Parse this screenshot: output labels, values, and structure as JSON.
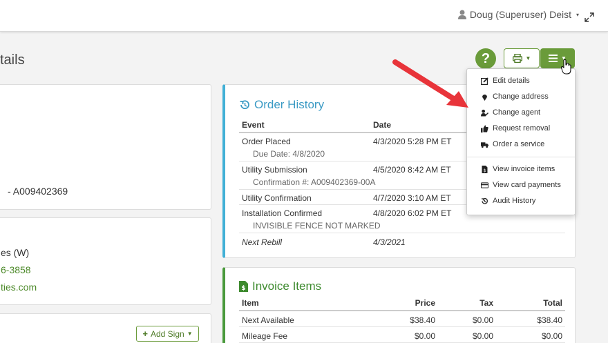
{
  "header": {
    "user_name": "Doug (Superuser) Deist",
    "page_title": "tails"
  },
  "left_panels": {
    "account_text": "- A009402369",
    "contact_label": "es (W)",
    "phone": "6-3858",
    "email": "ties.com",
    "add_sign_label": "Add Sign"
  },
  "order_history": {
    "title": "Order History",
    "columns": [
      "Event",
      "Date"
    ],
    "rows": [
      {
        "event": "Order Placed",
        "detail": "Due Date: 4/8/2020",
        "date": "4/3/2020 5:28 PM ET"
      },
      {
        "event": "Utility Submission",
        "detail": "Confirmation #: A009402369-00A",
        "date": "4/5/2020 8:42 AM ET"
      },
      {
        "event": "Utility Confirmation",
        "detail": "",
        "date": "4/7/2020 3:10 AM ET"
      },
      {
        "event": "Installation Confirmed",
        "detail": "INVISIBLE FENCE NOT MARKED",
        "date": "4/8/2020 6:02 PM ET"
      },
      {
        "event": "Next Rebill",
        "detail": "",
        "date": "4/3/2021"
      }
    ]
  },
  "invoice_items": {
    "title": "Invoice Items",
    "columns": [
      "Item",
      "Price",
      "Tax",
      "Total"
    ],
    "rows": [
      {
        "item": "Next Available",
        "price": "$38.40",
        "tax": "$0.00",
        "total": "$38.40"
      },
      {
        "item": "Mileage Fee",
        "price": "$0.00",
        "tax": "$0.00",
        "total": "$0.00"
      }
    ]
  },
  "actions_menu": {
    "items": [
      {
        "label": "Edit details",
        "icon": "edit-icon"
      },
      {
        "label": "Change address",
        "icon": "map-pin-icon"
      },
      {
        "label": "Change agent",
        "icon": "user-edit-icon"
      },
      {
        "label": "Request removal",
        "icon": "thumbs-up-icon"
      },
      {
        "label": "Order a service",
        "icon": "truck-icon"
      },
      {
        "label": "View invoice items",
        "icon": "invoice-icon"
      },
      {
        "label": "View card payments",
        "icon": "credit-card-icon"
      },
      {
        "label": "Audit History",
        "icon": "history-icon"
      }
    ]
  },
  "colors": {
    "brand_green": "#6a9b3a",
    "order_history_accent": "#41b0d6",
    "invoice_accent": "#4a9a3c",
    "annotation_arrow": "#e8343a"
  }
}
